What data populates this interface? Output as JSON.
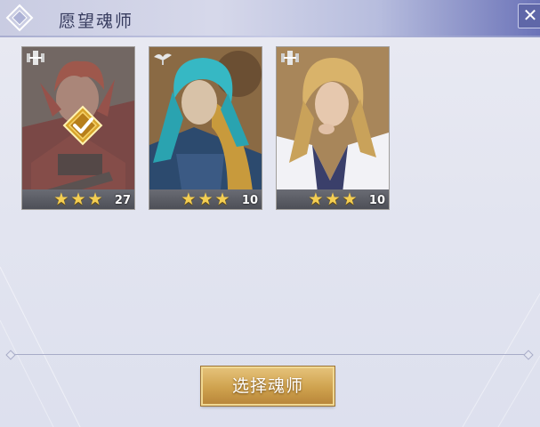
{
  "window": {
    "title": "愿望魂师",
    "close_glyph": "✕"
  },
  "cards": [
    {
      "id": "card-1",
      "class_icon": "tower-class-icon",
      "stars": 3,
      "level": "27",
      "selected": true,
      "hair_color": "#b5452c"
    },
    {
      "id": "card-2",
      "class_icon": "bird-class-icon",
      "stars": 3,
      "level": "10",
      "selected": false,
      "hair_color": "#36b8c4"
    },
    {
      "id": "card-3",
      "class_icon": "tower-class-icon",
      "stars": 3,
      "level": "10",
      "selected": false,
      "hair_color": "#d9b36a"
    }
  ],
  "star_glyph": "★",
  "action": {
    "select_label": "选择魂师"
  },
  "colors": {
    "accent_gold": "#cfa24e",
    "star": "#f4ce52",
    "header_blue": "#6b73b8"
  }
}
